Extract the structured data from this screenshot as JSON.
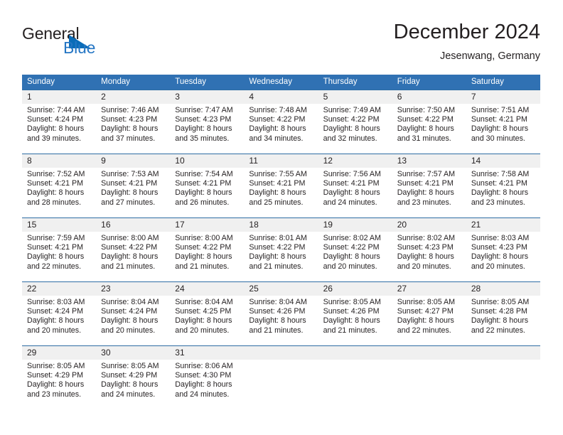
{
  "brand": {
    "word_one": "General",
    "word_two": "Blue",
    "triangle_color": "#0a6cb8",
    "blue_color": "#2576c4"
  },
  "header": {
    "title": "December 2024",
    "subtitle": "Jesenwang, Germany",
    "header_bar_color": "#3071b3",
    "daynum_strip_color": "#f0f0f0",
    "row_border_color": "#2e6da4"
  },
  "weekdays": [
    "Sunday",
    "Monday",
    "Tuesday",
    "Wednesday",
    "Thursday",
    "Friday",
    "Saturday"
  ],
  "weeks": [
    [
      {
        "day": "1",
        "sunrise": "Sunrise: 7:44 AM",
        "sunset": "Sunset: 4:24 PM",
        "daylight1": "Daylight: 8 hours",
        "daylight2": "and 39 minutes."
      },
      {
        "day": "2",
        "sunrise": "Sunrise: 7:46 AM",
        "sunset": "Sunset: 4:23 PM",
        "daylight1": "Daylight: 8 hours",
        "daylight2": "and 37 minutes."
      },
      {
        "day": "3",
        "sunrise": "Sunrise: 7:47 AM",
        "sunset": "Sunset: 4:23 PM",
        "daylight1": "Daylight: 8 hours",
        "daylight2": "and 35 minutes."
      },
      {
        "day": "4",
        "sunrise": "Sunrise: 7:48 AM",
        "sunset": "Sunset: 4:22 PM",
        "daylight1": "Daylight: 8 hours",
        "daylight2": "and 34 minutes."
      },
      {
        "day": "5",
        "sunrise": "Sunrise: 7:49 AM",
        "sunset": "Sunset: 4:22 PM",
        "daylight1": "Daylight: 8 hours",
        "daylight2": "and 32 minutes."
      },
      {
        "day": "6",
        "sunrise": "Sunrise: 7:50 AM",
        "sunset": "Sunset: 4:22 PM",
        "daylight1": "Daylight: 8 hours",
        "daylight2": "and 31 minutes."
      },
      {
        "day": "7",
        "sunrise": "Sunrise: 7:51 AM",
        "sunset": "Sunset: 4:21 PM",
        "daylight1": "Daylight: 8 hours",
        "daylight2": "and 30 minutes."
      }
    ],
    [
      {
        "day": "8",
        "sunrise": "Sunrise: 7:52 AM",
        "sunset": "Sunset: 4:21 PM",
        "daylight1": "Daylight: 8 hours",
        "daylight2": "and 28 minutes."
      },
      {
        "day": "9",
        "sunrise": "Sunrise: 7:53 AM",
        "sunset": "Sunset: 4:21 PM",
        "daylight1": "Daylight: 8 hours",
        "daylight2": "and 27 minutes."
      },
      {
        "day": "10",
        "sunrise": "Sunrise: 7:54 AM",
        "sunset": "Sunset: 4:21 PM",
        "daylight1": "Daylight: 8 hours",
        "daylight2": "and 26 minutes."
      },
      {
        "day": "11",
        "sunrise": "Sunrise: 7:55 AM",
        "sunset": "Sunset: 4:21 PM",
        "daylight1": "Daylight: 8 hours",
        "daylight2": "and 25 minutes."
      },
      {
        "day": "12",
        "sunrise": "Sunrise: 7:56 AM",
        "sunset": "Sunset: 4:21 PM",
        "daylight1": "Daylight: 8 hours",
        "daylight2": "and 24 minutes."
      },
      {
        "day": "13",
        "sunrise": "Sunrise: 7:57 AM",
        "sunset": "Sunset: 4:21 PM",
        "daylight1": "Daylight: 8 hours",
        "daylight2": "and 23 minutes."
      },
      {
        "day": "14",
        "sunrise": "Sunrise: 7:58 AM",
        "sunset": "Sunset: 4:21 PM",
        "daylight1": "Daylight: 8 hours",
        "daylight2": "and 23 minutes."
      }
    ],
    [
      {
        "day": "15",
        "sunrise": "Sunrise: 7:59 AM",
        "sunset": "Sunset: 4:21 PM",
        "daylight1": "Daylight: 8 hours",
        "daylight2": "and 22 minutes."
      },
      {
        "day": "16",
        "sunrise": "Sunrise: 8:00 AM",
        "sunset": "Sunset: 4:22 PM",
        "daylight1": "Daylight: 8 hours",
        "daylight2": "and 21 minutes."
      },
      {
        "day": "17",
        "sunrise": "Sunrise: 8:00 AM",
        "sunset": "Sunset: 4:22 PM",
        "daylight1": "Daylight: 8 hours",
        "daylight2": "and 21 minutes."
      },
      {
        "day": "18",
        "sunrise": "Sunrise: 8:01 AM",
        "sunset": "Sunset: 4:22 PM",
        "daylight1": "Daylight: 8 hours",
        "daylight2": "and 21 minutes."
      },
      {
        "day": "19",
        "sunrise": "Sunrise: 8:02 AM",
        "sunset": "Sunset: 4:22 PM",
        "daylight1": "Daylight: 8 hours",
        "daylight2": "and 20 minutes."
      },
      {
        "day": "20",
        "sunrise": "Sunrise: 8:02 AM",
        "sunset": "Sunset: 4:23 PM",
        "daylight1": "Daylight: 8 hours",
        "daylight2": "and 20 minutes."
      },
      {
        "day": "21",
        "sunrise": "Sunrise: 8:03 AM",
        "sunset": "Sunset: 4:23 PM",
        "daylight1": "Daylight: 8 hours",
        "daylight2": "and 20 minutes."
      }
    ],
    [
      {
        "day": "22",
        "sunrise": "Sunrise: 8:03 AM",
        "sunset": "Sunset: 4:24 PM",
        "daylight1": "Daylight: 8 hours",
        "daylight2": "and 20 minutes."
      },
      {
        "day": "23",
        "sunrise": "Sunrise: 8:04 AM",
        "sunset": "Sunset: 4:24 PM",
        "daylight1": "Daylight: 8 hours",
        "daylight2": "and 20 minutes."
      },
      {
        "day": "24",
        "sunrise": "Sunrise: 8:04 AM",
        "sunset": "Sunset: 4:25 PM",
        "daylight1": "Daylight: 8 hours",
        "daylight2": "and 20 minutes."
      },
      {
        "day": "25",
        "sunrise": "Sunrise: 8:04 AM",
        "sunset": "Sunset: 4:26 PM",
        "daylight1": "Daylight: 8 hours",
        "daylight2": "and 21 minutes."
      },
      {
        "day": "26",
        "sunrise": "Sunrise: 8:05 AM",
        "sunset": "Sunset: 4:26 PM",
        "daylight1": "Daylight: 8 hours",
        "daylight2": "and 21 minutes."
      },
      {
        "day": "27",
        "sunrise": "Sunrise: 8:05 AM",
        "sunset": "Sunset: 4:27 PM",
        "daylight1": "Daylight: 8 hours",
        "daylight2": "and 22 minutes."
      },
      {
        "day": "28",
        "sunrise": "Sunrise: 8:05 AM",
        "sunset": "Sunset: 4:28 PM",
        "daylight1": "Daylight: 8 hours",
        "daylight2": "and 22 minutes."
      }
    ],
    [
      {
        "day": "29",
        "sunrise": "Sunrise: 8:05 AM",
        "sunset": "Sunset: 4:29 PM",
        "daylight1": "Daylight: 8 hours",
        "daylight2": "and 23 minutes."
      },
      {
        "day": "30",
        "sunrise": "Sunrise: 8:05 AM",
        "sunset": "Sunset: 4:29 PM",
        "daylight1": "Daylight: 8 hours",
        "daylight2": "and 24 minutes."
      },
      {
        "day": "31",
        "sunrise": "Sunrise: 8:06 AM",
        "sunset": "Sunset: 4:30 PM",
        "daylight1": "Daylight: 8 hours",
        "daylight2": "and 24 minutes."
      },
      {
        "day": "",
        "sunrise": "",
        "sunset": "",
        "daylight1": "",
        "daylight2": ""
      },
      {
        "day": "",
        "sunrise": "",
        "sunset": "",
        "daylight1": "",
        "daylight2": ""
      },
      {
        "day": "",
        "sunrise": "",
        "sunset": "",
        "daylight1": "",
        "daylight2": ""
      },
      {
        "day": "",
        "sunrise": "",
        "sunset": "",
        "daylight1": "",
        "daylight2": ""
      }
    ]
  ]
}
